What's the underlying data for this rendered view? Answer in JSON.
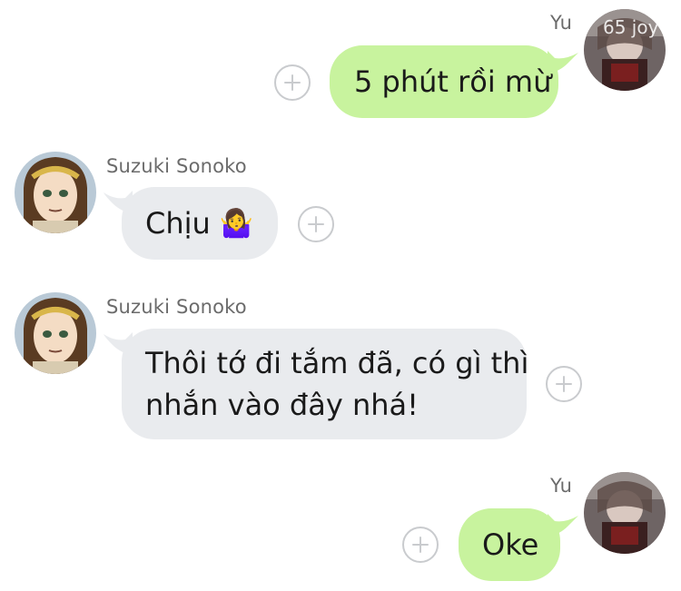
{
  "messages": [
    {
      "sender": "Yu",
      "text": "5 phút rồi mừ",
      "avatar_overlay_text": "65 joy"
    },
    {
      "sender": "Suzuki Sonoko",
      "text": "Chịu",
      "emoji": "🤷‍♀️"
    },
    {
      "sender": "Suzuki Sonoko",
      "text_line1": "Thôi tớ đi tắm đã, có gì thì",
      "text_line2": "nhắn vào đây nhá!"
    },
    {
      "sender": "Yu",
      "text": "Oke"
    }
  ],
  "colors": {
    "outgoing_bubble": "#c8f39e",
    "incoming_bubble": "#e9ebee",
    "name_text": "#6b6b6b",
    "plus_ring": "#c9cbce"
  },
  "icons": {
    "add_reaction": "plus-circle-icon"
  }
}
